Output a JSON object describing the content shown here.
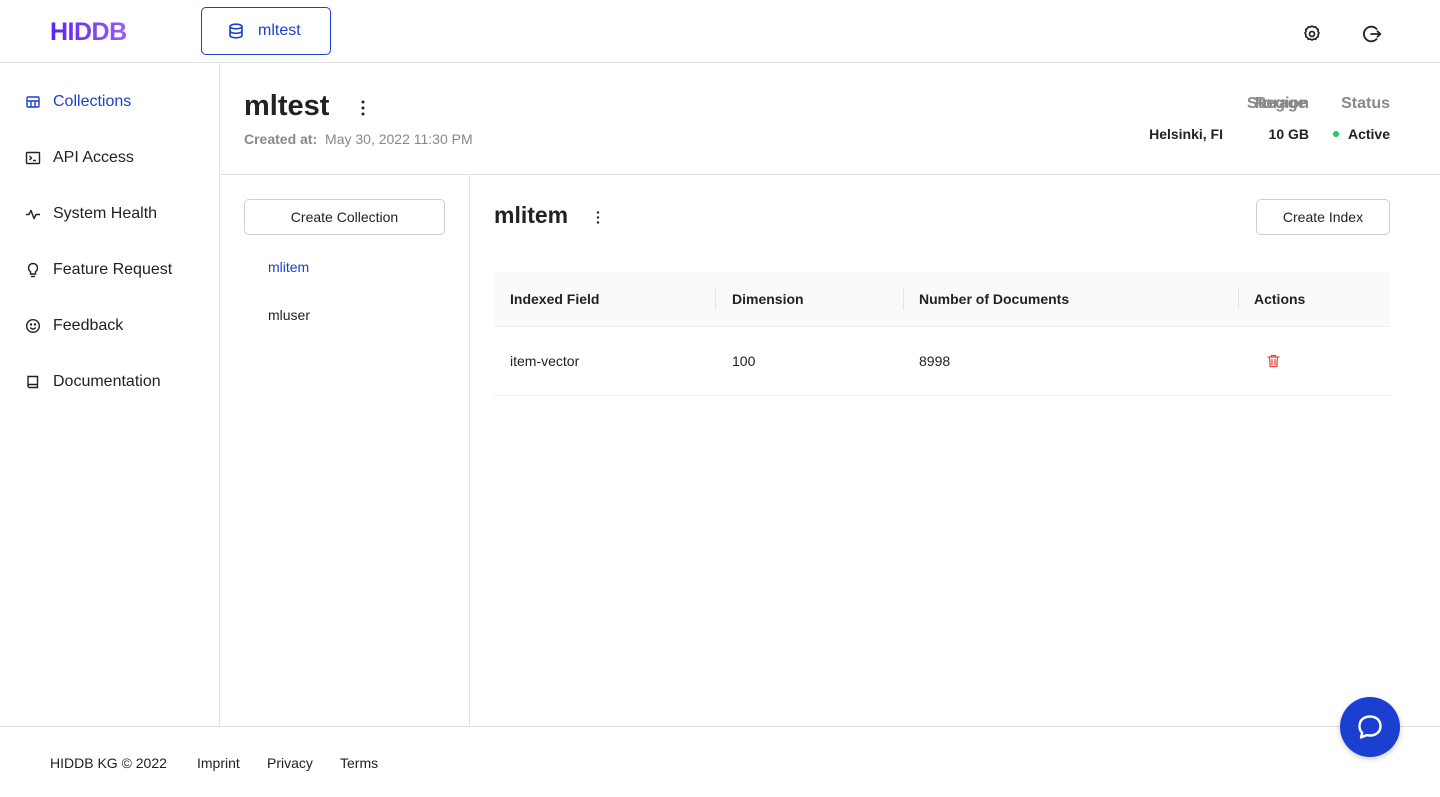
{
  "app": {
    "logo": "HIDDB",
    "database_pill": "mltest"
  },
  "topbar": {
    "settings_icon": "gear-icon",
    "logout_icon": "logout-icon"
  },
  "sidebar": {
    "items": [
      {
        "label": "Collections",
        "icon": "collections-icon",
        "active": true
      },
      {
        "label": "API Access",
        "icon": "terminal-icon",
        "active": false
      },
      {
        "label": "System Health",
        "icon": "pulse-icon",
        "active": false
      },
      {
        "label": "Feature Request",
        "icon": "lightbulb-icon",
        "active": false
      },
      {
        "label": "Feedback",
        "icon": "smiley-icon",
        "active": false
      },
      {
        "label": "Documentation",
        "icon": "book-icon",
        "active": false
      }
    ]
  },
  "database": {
    "name": "mltest",
    "created_label": "Created at:",
    "created_value": "May 30, 2022 11:30 PM",
    "region_label": "Region",
    "region_value": "Helsinki, FI",
    "storage_label": "Storage",
    "storage_value": "10 GB",
    "status_label": "Status",
    "status_value": "Active",
    "status_color": "#22c55e"
  },
  "collections": {
    "create_label": "Create Collection",
    "items": [
      {
        "name": "mlitem",
        "active": true
      },
      {
        "name": "mluser",
        "active": false
      }
    ]
  },
  "collection": {
    "name": "mlitem",
    "create_index_label": "Create Index",
    "columns": [
      "Indexed Field",
      "Dimension",
      "Number of Documents",
      "Actions"
    ],
    "rows": [
      {
        "field": "item-vector",
        "dimension": "100",
        "documents": "8998",
        "action_icon": "trash-icon"
      }
    ]
  },
  "footer": {
    "copyright": "HIDDB KG © 2022",
    "imprint": "Imprint",
    "privacy": "Privacy",
    "terms": "Terms"
  },
  "colors": {
    "accent": "#1b3fd1",
    "brand": "#6d28d9",
    "danger": "#ef4444"
  }
}
